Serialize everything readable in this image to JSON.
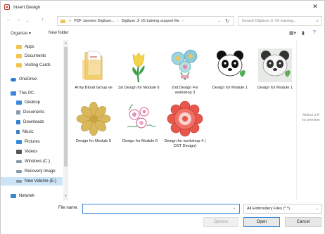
{
  "window": {
    "title": "Insert Design",
    "close_glyph": "✕"
  },
  "address": {
    "crumbs": [
      "PDF Janome Digitizer...",
      "Digitizer Jr V5 training support file"
    ],
    "prefix": "«",
    "separator": "›",
    "search_placeholder": "Search Digitizer Jr V5 training..."
  },
  "toolbar": {
    "organize": "Organize ▾",
    "new_folder": "New folder"
  },
  "nav": {
    "items": [
      {
        "label": "Apps",
        "icon": "folder-icon"
      },
      {
        "label": "Documents",
        "icon": "folder-icon"
      },
      {
        "label": "Visiting Cards",
        "icon": "folder-icon"
      },
      {
        "label": "OneDrive",
        "icon": "cloud-icon"
      },
      {
        "label": "This PC",
        "icon": "pc-icon"
      },
      {
        "label": "Desktop",
        "icon": "desktop-icon"
      },
      {
        "label": "Documents",
        "icon": "documents-icon"
      },
      {
        "label": "Downloads",
        "icon": "download-icon"
      },
      {
        "label": "Music",
        "icon": "music-icon"
      },
      {
        "label": "Pictures",
        "icon": "pictures-icon"
      },
      {
        "label": "Videos",
        "icon": "videos-icon"
      },
      {
        "label": "Windows (C:)",
        "icon": "drive-icon"
      },
      {
        "label": "Recovery Image",
        "icon": "drive-icon"
      },
      {
        "label": "New Volume (E:)",
        "icon": "drive-icon"
      },
      {
        "label": "Network",
        "icon": "network-icon"
      }
    ]
  },
  "files": [
    {
      "name": "Army Blood Group ve",
      "icon": "folder-document-icon"
    },
    {
      "name": "1st Design for Module 6",
      "icon": "tulip-design-icon"
    },
    {
      "name": "2nd Design For workshop 3",
      "icon": "flower-bouquet-design-icon"
    },
    {
      "name": "Design for Module 1",
      "icon": "panda-design-icon"
    },
    {
      "name": "Design for Module 1",
      "icon": "panda-design-icon"
    },
    {
      "name": "Design for Module 5",
      "icon": "gold-flower-design-icon"
    },
    {
      "name": "Design for Module 6",
      "icon": "floral-sketch-design-icon"
    },
    {
      "name": "Design for workshop 4 ( DST Design)",
      "icon": "red-mandala-design-icon"
    }
  ],
  "preview_hint": [
    "Select a fi",
    "to preview"
  ],
  "bottom": {
    "file_name_label": "File name:",
    "file_name_value": "",
    "file_type": "All Embroidery Files (*.*)",
    "options": "Options",
    "open": "Open",
    "cancel": "Cancel"
  },
  "colors": {
    "accent": "#3c8ad8",
    "selection": "#cde4f7",
    "folder": "#f4c44b"
  }
}
